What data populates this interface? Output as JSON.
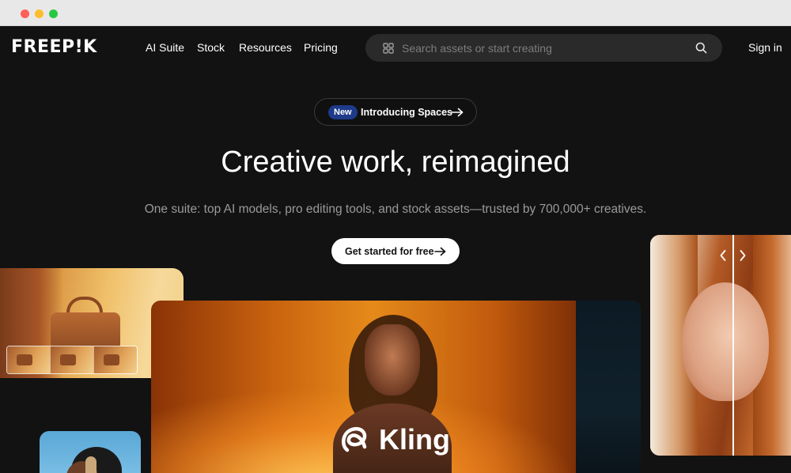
{
  "window": {
    "controls": [
      "close",
      "minimize",
      "maximize"
    ]
  },
  "nav": {
    "logo": "FREEP!K",
    "links": [
      "AI Suite",
      "Stock",
      "Resources",
      "Pricing"
    ],
    "search_placeholder": "Search assets or start creating",
    "search_icon": "grid-icon",
    "search_button_icon": "search-icon",
    "sign_in": "Sign in"
  },
  "hero": {
    "badge": "New",
    "announcement": "Introducing Spaces",
    "headline": "Creative work, reimagined",
    "subline": "One suite: top AI models, pro editing tools, and stock assets—trusted by 700,000+ creatives.",
    "cta": "Get started for free"
  },
  "showcase": {
    "video_brand": "Kling"
  },
  "colors": {
    "background": "#121212",
    "badge": "#1e3a8a",
    "search_bg": "#2a2a2a"
  }
}
